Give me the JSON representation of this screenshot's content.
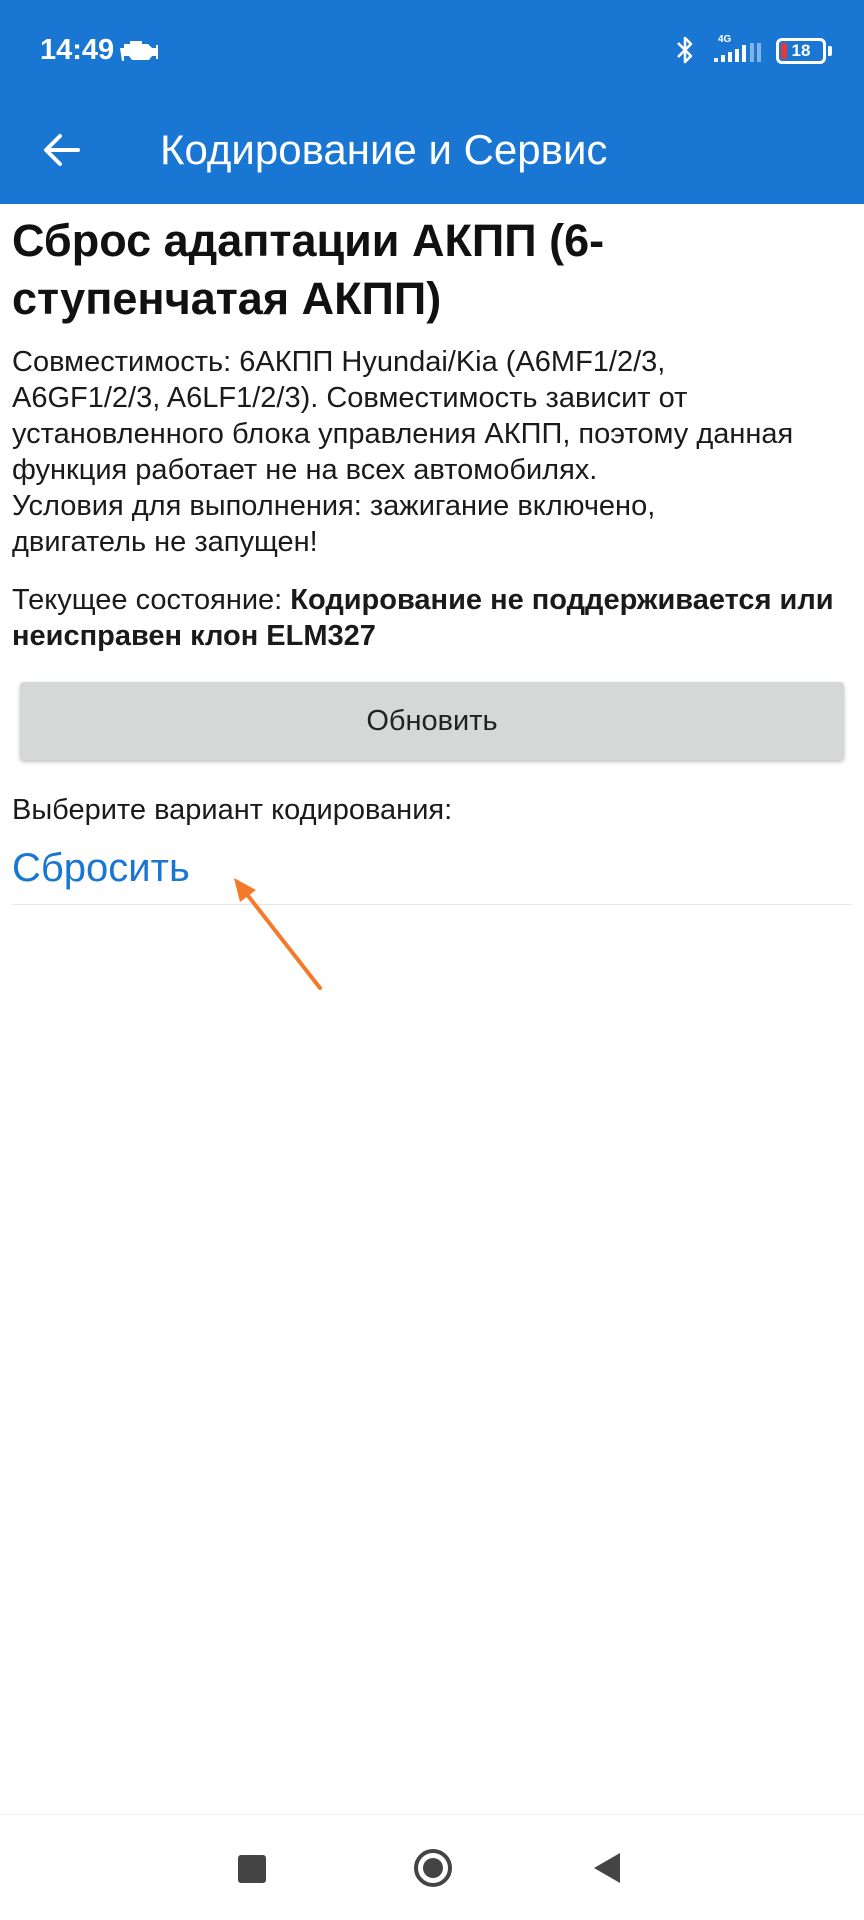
{
  "status_bar": {
    "time": "14:49",
    "network_type": "4G",
    "battery_level": "18",
    "icons": [
      "check-engine-icon",
      "bluetooth-icon",
      "signal-icon",
      "battery-icon"
    ]
  },
  "app_bar": {
    "title": "Кодирование и Сервис",
    "back_icon": "arrow-left-icon"
  },
  "main": {
    "title": "Сброс адаптации АКПП (6-ступенчатая АКПП)",
    "description_lines": [
      "Совместимость: 6АКПП Hyundai/Kia (A6MF1/2/3,",
      "A6GF1/2/3, A6LF1/2/3). Совместимость зависит от",
      "установленного блока управления АКПП, поэтому данная",
      "функция работает не на всех автомобилях.",
      "Условия для выполнения: зажигание включено,",
      "двигатель не запущен!"
    ],
    "state_label": "Текущее состояние: ",
    "state_value": "Кодирование не поддерживается или неисправен клон ELM327",
    "refresh_button": "Обновить",
    "choose_label": "Выберите вариант кодирования:",
    "options": [
      "Сбросить"
    ]
  },
  "colors": {
    "primary": "#1976d2",
    "button_bg": "#d6d7d7",
    "annotation_arrow": "#f47a2a",
    "battery_low": "#e53935"
  },
  "nav_bar": {
    "icons": [
      "recents-square-icon",
      "home-circle-icon",
      "back-triangle-icon"
    ]
  }
}
